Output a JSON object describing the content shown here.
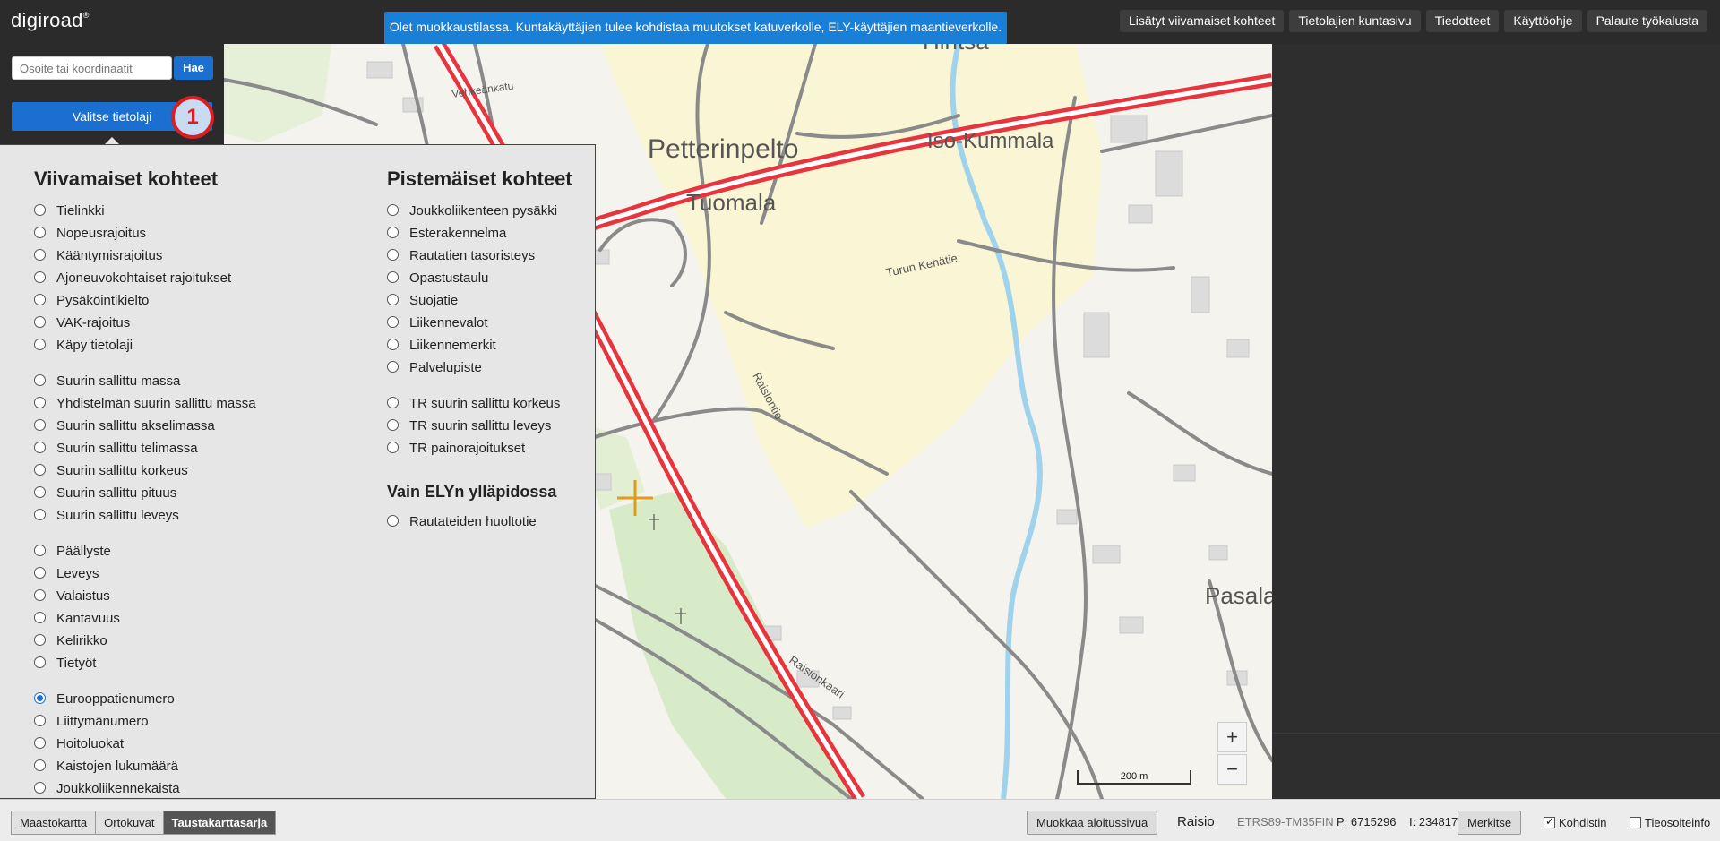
{
  "app": {
    "logo": "digiroad",
    "logo_mark": "®"
  },
  "notice": "Olet muokkaustilassa. Kuntakäyttäjien tulee kohdistaa muutokset katuverkolle, ELY-käyttäjien maantieverkolle.",
  "toplinks": [
    "Lisätyt viivamaiset kohteet",
    "Tietolajien kuntasivu",
    "Tiedotteet",
    "Käyttöohje",
    "Palaute työkalusta"
  ],
  "search": {
    "placeholder": "Osoite tai koordinaatit",
    "button": "Hae"
  },
  "select_layer_button": "Valitse tietolaji",
  "step_badge": "1",
  "panel": {
    "linear_title": "Viivamaiset kohteet",
    "linear_groups": [
      [
        "Tielinkki",
        "Nopeusrajoitus",
        "Kääntymisrajoitus",
        "Ajoneuvokohtaiset rajoitukset",
        "Pysäköintikielto",
        "VAK-rajoitus",
        "Käpy tietolaji"
      ],
      [
        "Suurin sallittu massa",
        "Yhdistelmän suurin sallittu massa",
        "Suurin sallittu akselimassa",
        "Suurin sallittu telimassa",
        "Suurin sallittu korkeus",
        "Suurin sallittu pituus",
        "Suurin sallittu leveys"
      ],
      [
        "Päällyste",
        "Leveys",
        "Valaistus",
        "Kantavuus",
        "Kelirikko",
        "Tietyöt"
      ],
      [
        "Eurooppatienumero",
        "Liittymänumero",
        "Hoitoluokat",
        "Kaistojen lukumäärä",
        "Joukkoliikennekaista"
      ]
    ],
    "selected": "Eurooppatienumero",
    "point_title": "Pistemäiset kohteet",
    "point_groups": [
      [
        "Joukkoliikenteen pysäkki",
        "Esterakennelma",
        "Rautatien tasoristeys",
        "Opastustaulu",
        "Suojatie",
        "Liikennevalot",
        "Liikennemerkit",
        "Palvelupiste"
      ],
      [
        "TR suurin sallittu korkeus",
        "TR suurin sallittu leveys",
        "TR painorajoitukset"
      ]
    ],
    "ely_title": "Vain ELYn ylläpidossa",
    "ely_items": [
      "Rautateiden huoltotie"
    ]
  },
  "map": {
    "labels": {
      "petterinpelto": "Petterinpelto",
      "tuomala": "Tuomala",
      "iso_kummala": "Iso-Kummala",
      "pasala": "Pasala",
      "hintsa": "Hintsa",
      "turun_kehatie": "Turun Kehätie",
      "raisionkaari": "Raisionkaari",
      "vehkeankatu": "Vehkeänkatu",
      "raisiontie": "Raisiontie"
    },
    "scale_label": "200 m",
    "zoom_in": "+",
    "zoom_out": "−",
    "colors": {
      "highway": "#e8343c",
      "road": "#8a8a8a",
      "water": "#9fd3ec",
      "field": "#faf5d4",
      "park": "#d8ebc8"
    }
  },
  "bottom": {
    "basemaps": [
      "Maastokartta",
      "Ortokuvat",
      "Taustakarttasarja"
    ],
    "active_basemap": "Taustakarttasarja",
    "edit_start": "Muokkaa aloitussivua",
    "municipality": "Raisio",
    "coord_system": "ETRS89-TM35FIN",
    "coord_p": "P: 6715296",
    "coord_i": "I: 234817",
    "mark_button": "Merkitse",
    "chk_kohdistin": {
      "label": "Kohdistin",
      "checked": true
    },
    "chk_tieosoite": {
      "label": "Tieosoiteinfo",
      "checked": false
    }
  }
}
